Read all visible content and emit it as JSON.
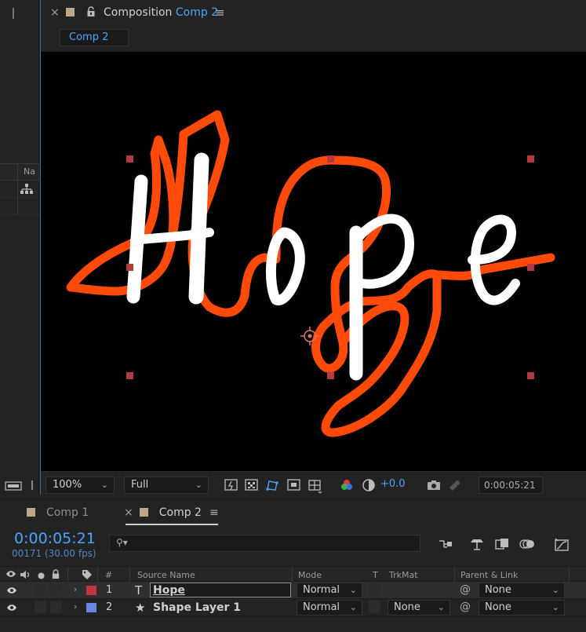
{
  "composition_panel": {
    "close_glyph": "×",
    "title_prefix": "Composition",
    "title_comp": "Comp 2",
    "subtab_label": "Comp 2"
  },
  "left_panel": {
    "column_label": "Na"
  },
  "viewer": {
    "layer_text": "Hope"
  },
  "viewer_toolbar": {
    "zoom": "100%",
    "resolution": "Full",
    "exposure": "+0.0",
    "current_time": "0:00:05:21"
  },
  "timeline": {
    "tabs": [
      {
        "label": "Comp 1"
      },
      {
        "label": "Comp 2"
      }
    ],
    "timecode": "0:00:05:21",
    "frames_info": "00171 (30.00 fps)",
    "search_placeholder": "",
    "columns": {
      "number": "#",
      "source_name": "Source Name",
      "mode": "Mode",
      "t": "T",
      "trkmat": "TrkMat",
      "parent_link": "Parent & Link"
    },
    "layers": [
      {
        "number": "1",
        "type_glyph": "T",
        "name": "Hope",
        "mode": "Normal",
        "trkmat": "",
        "parent": "None",
        "label_color": "#c0383a"
      },
      {
        "number": "2",
        "type_glyph": "★",
        "name": "Shape Layer 1",
        "mode": "Normal",
        "trkmat": "None",
        "parent": "None",
        "label_color": "#6a86e0"
      }
    ]
  },
  "colors": {
    "accent_blue": "#4aa3ff",
    "stroke_orange": "#ff4a0a",
    "handle_red": "#b23a3e"
  }
}
